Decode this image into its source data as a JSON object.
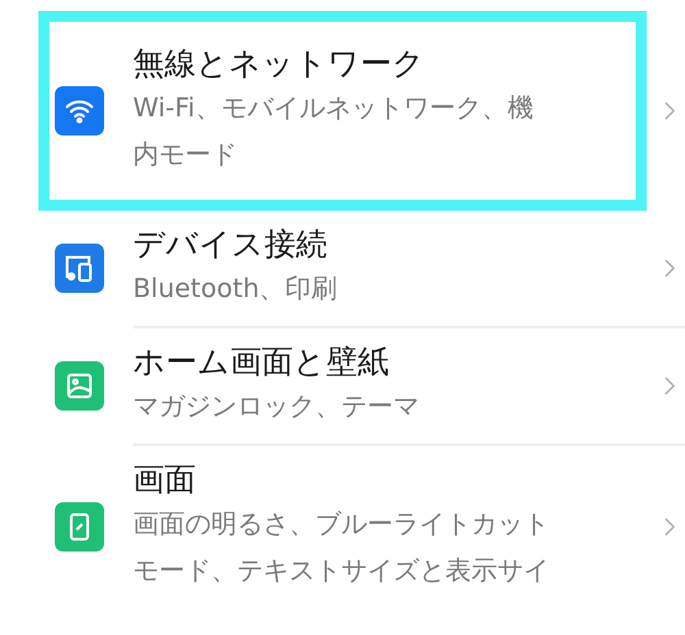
{
  "settings_items": [
    {
      "title": "無線とネットワーク",
      "subtitle": "Wi-Fi、モバイルネットワーク、機内モード",
      "selected": true,
      "icon": {
        "kind": "wifi",
        "color": "#1677f2"
      }
    },
    {
      "title": "デバイス接続",
      "subtitle": "Bluetooth、印刷",
      "selected": false,
      "icon": {
        "kind": "devices",
        "color": "#1f7be8"
      }
    },
    {
      "title": "ホーム画面と壁紙",
      "subtitle": "マガジンロック、テーマ",
      "selected": false,
      "icon": {
        "kind": "wallpaper",
        "color": "#1fbf76"
      }
    },
    {
      "title": "画面",
      "subtitle": "画面の明るさ、ブルーライトカットモード、テキストサイズと表示サイ",
      "selected": false,
      "icon": {
        "kind": "display",
        "color": "#1fbf76"
      }
    }
  ]
}
